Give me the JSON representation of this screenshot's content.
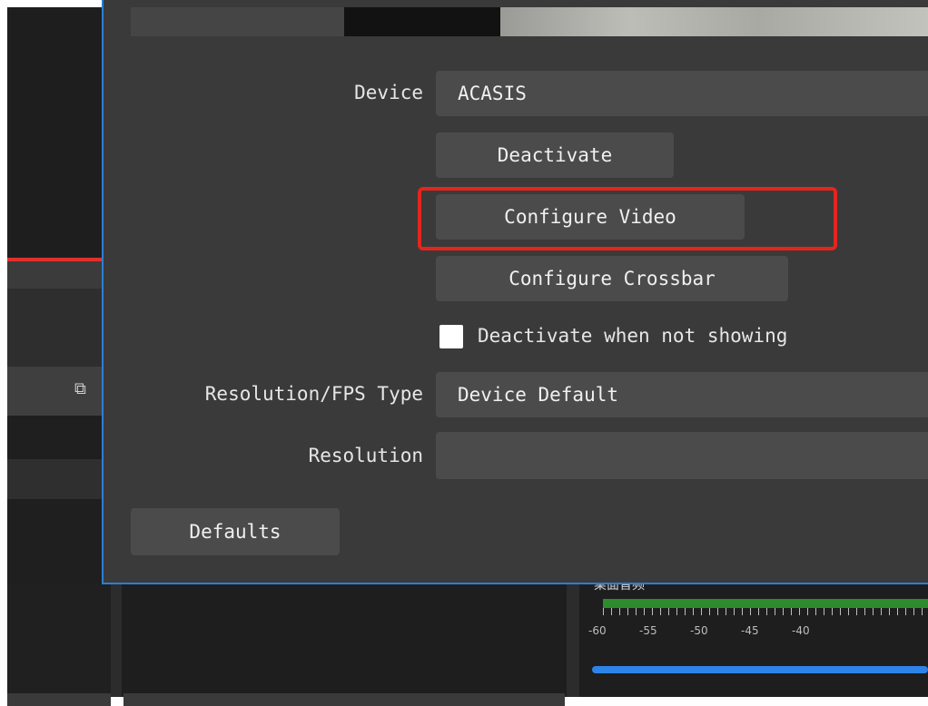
{
  "dialog": {
    "device_label": "Device",
    "device_value": "ACASIS",
    "deactivate_button": "Deactivate",
    "configure_video_button": "Configure Video",
    "configure_crossbar_button": "Configure Crossbar",
    "deactivate_when_not_showing_label": "Deactivate when not showing",
    "deactivate_when_not_showing_checked": false,
    "resolution_fps_type_label": "Resolution/FPS Type",
    "resolution_fps_type_value": "Device Default",
    "resolution_label": "Resolution",
    "resolution_value": "",
    "defaults_button": "Defaults",
    "highlight_color": "#e4251c",
    "accent_border_color": "#2a7fd6"
  },
  "background": {
    "audio_meter_label": "桌面音频",
    "meter_scale": [
      "-60",
      "-55",
      "-50",
      "-45",
      "-40"
    ]
  }
}
